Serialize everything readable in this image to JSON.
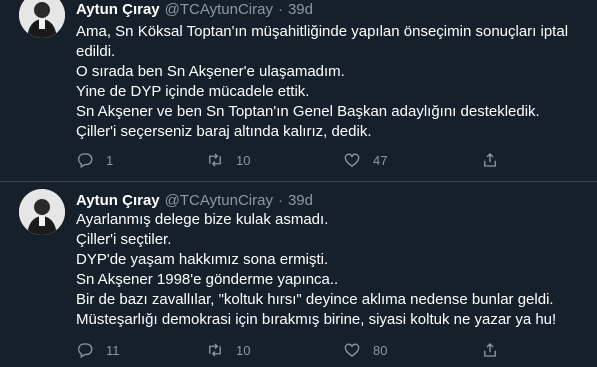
{
  "tweets": [
    {
      "name": "Aytun Çıray",
      "handle": "@TCAytunCiray",
      "separator": "·",
      "time": "39d",
      "lines": [
        "Ama, Sn Köksal Toptan'ın müşahitliğinde yapılan önseçimin sonuçları iptal",
        "edildi.",
        "O sırada ben Sn Akşener'e ulaşamadım.",
        "Yine de DYP içinde mücadele ettik.",
        "Sn Akşener ve ben Sn Toptan'ın Genel Başkan adaylığını destekledik.",
        "Çiller'i seçerseniz baraj altında kalırız, dedik."
      ],
      "replies": "1",
      "retweets": "10",
      "likes": "47"
    },
    {
      "name": "Aytun Çıray",
      "handle": "@TCAytunCiray",
      "separator": "·",
      "time": "39d",
      "lines": [
        "Ayarlanmış delege bize kulak asmadı.",
        "Çiller'i seçtiler.",
        "DYP'de yaşam hakkımız sona ermişti.",
        "Sn Akşener 1998'e gönderme yapınca..",
        "Bir de bazı zavallılar, \"koltuk hırsı\" deyince aklıma nedense bunlar geldi.",
        "Müsteşarlığı demokrasi için bırakmış birine, siyasi koltuk ne yazar ya hu!"
      ],
      "replies": "11",
      "retweets": "10",
      "likes": "80"
    }
  ],
  "icons": {
    "reply": "reply-icon",
    "retweet": "retweet-icon",
    "like": "heart-icon",
    "share": "share-icon"
  },
  "colors": {
    "background": "#15202b",
    "secondary_text": "#8899a6",
    "divider": "#38444d"
  }
}
